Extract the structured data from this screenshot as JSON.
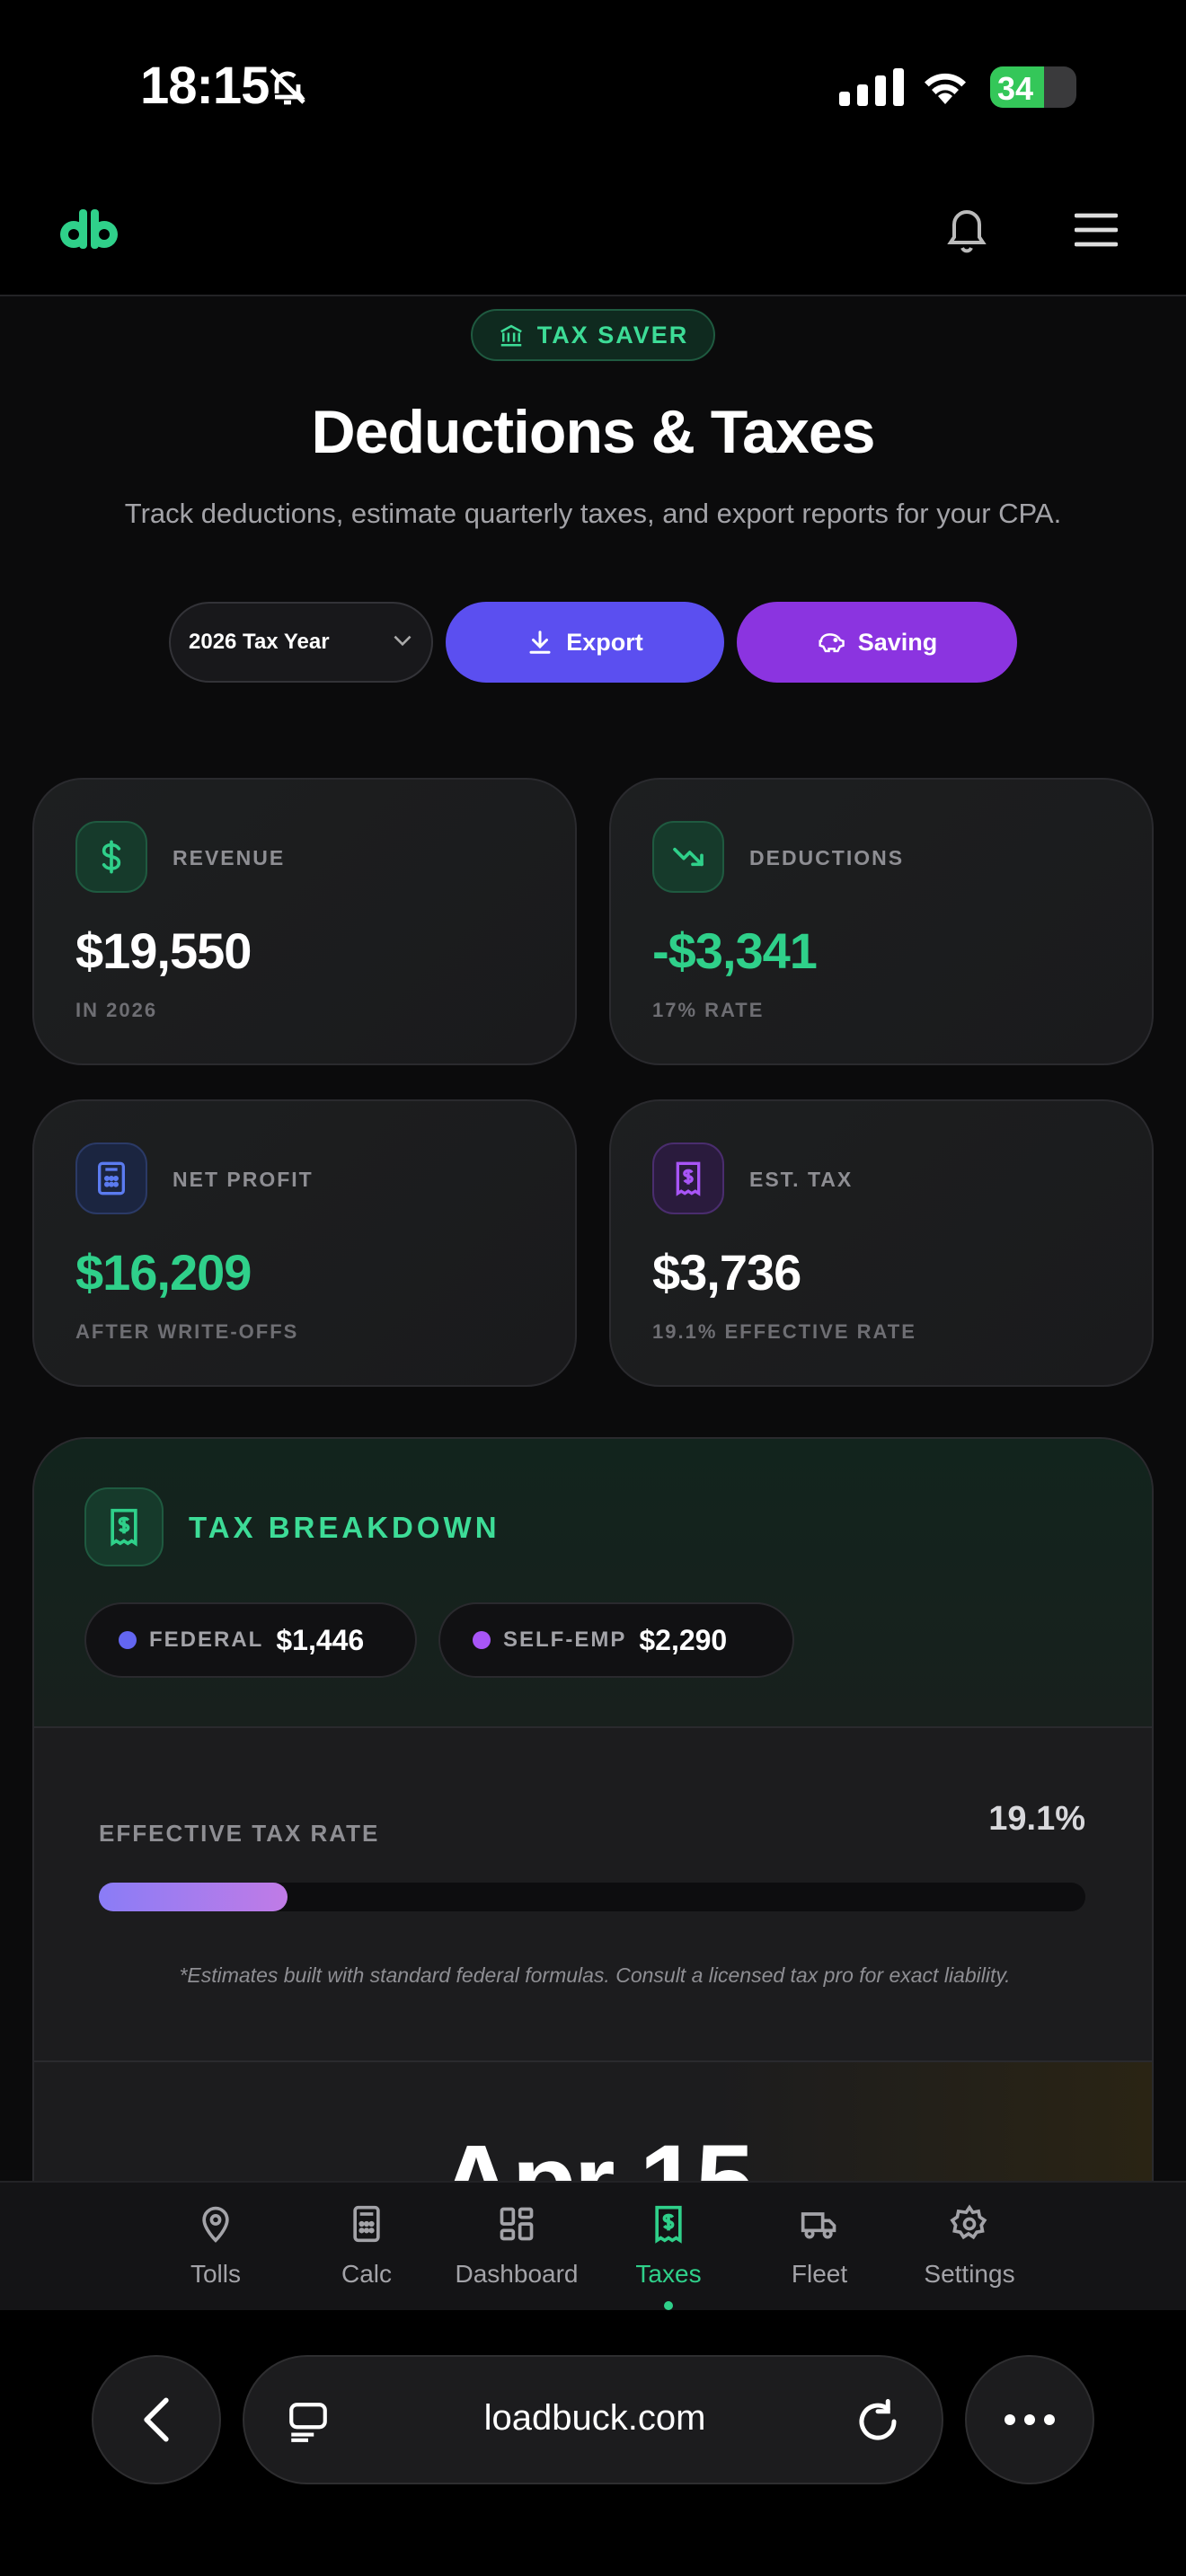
{
  "status_bar": {
    "time": "18:15",
    "battery": "34"
  },
  "header": {
    "logo_icon": "loadbuck-logo",
    "bell_icon": "bell-icon",
    "menu_icon": "hamburger-menu-icon"
  },
  "page": {
    "badge": "TAX SAVER",
    "title": "Deductions & Taxes",
    "subtitle": "Track deductions, estimate quarterly taxes, and export reports for your CPA."
  },
  "controls": {
    "year_select": "2026 Tax Year",
    "export_label": "Export",
    "saving_label": "Saving"
  },
  "stats": [
    {
      "label": "REVENUE",
      "value": "$19,550",
      "sub": "IN 2026",
      "icon": "dollar-icon",
      "accent": "#2fd08a"
    },
    {
      "label": "DEDUCTIONS",
      "value": "-$3,341",
      "sub": "17% RATE",
      "icon": "trending-down-icon",
      "accent": "#2fd08a"
    },
    {
      "label": "NET PROFIT",
      "value": "$16,209",
      "sub": "AFTER WRITE-OFFS",
      "icon": "calculator-icon",
      "accent": "#5b7bf0"
    },
    {
      "label": "EST. TAX",
      "value": "$3,736",
      "sub": "19.1% EFFECTIVE RATE",
      "icon": "receipt-icon",
      "accent": "#a855f7"
    }
  ],
  "breakdown": {
    "title": "TAX BREAKDOWN",
    "federal_label": "FEDERAL",
    "federal_value": "$1,446",
    "federal_color": "#6366f1",
    "selfemp_label": "SELF-EMP",
    "selfemp_value": "$2,290",
    "selfemp_color": "#a855f7",
    "rate_label": "EFFECTIVE TAX RATE",
    "rate_value": "19.1%",
    "rate_fraction": 0.191,
    "note": "*Estimates built with standard federal formulas. Consult a licensed tax pro for exact liability.",
    "deadline": "Apr 15"
  },
  "tabs": [
    {
      "label": "Tolls",
      "icon": "map-pin-icon"
    },
    {
      "label": "Calc",
      "icon": "calculator-icon"
    },
    {
      "label": "Dashboard",
      "icon": "dashboard-icon"
    },
    {
      "label": "Taxes",
      "icon": "receipt-icon",
      "active": true
    },
    {
      "label": "Fleet",
      "icon": "truck-icon"
    },
    {
      "label": "Settings",
      "icon": "gear-icon"
    }
  ],
  "browser": {
    "url": "loadbuck.com"
  },
  "colors": {
    "accent_green": "#2fd08a",
    "export": "#5b4ff0",
    "saving": "#8b34e0"
  }
}
